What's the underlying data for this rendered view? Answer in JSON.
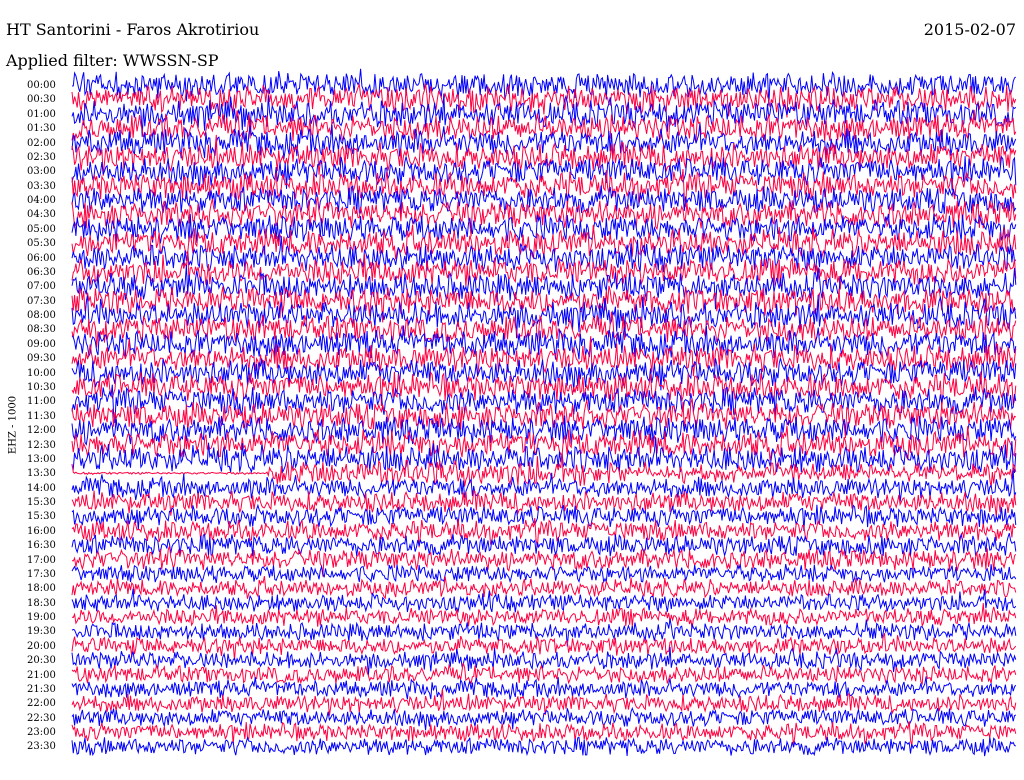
{
  "header": {
    "station": "HT Santorini - Faros Akrotiriou",
    "date": "2015-02-07",
    "filter": "Applied filter: WWSSN-SP"
  },
  "chart_data": {
    "type": "line",
    "title": "HT Santorini - Faros Akrotiriou",
    "ylabel": "EHZ - 1000",
    "xlabel": "",
    "categories": [
      "00:00",
      "00:30",
      "01:00",
      "01:30",
      "02:00",
      "02:30",
      "03:00",
      "03:30",
      "04:00",
      "04:30",
      "05:00",
      "05:30",
      "06:00",
      "06:30",
      "07:00",
      "07:30",
      "08:00",
      "08:30",
      "09:00",
      "09:30",
      "10:00",
      "10:30",
      "11:00",
      "11:30",
      "12:00",
      "12:30",
      "13:00",
      "13:30",
      "14:00",
      "14:30",
      "15:00",
      "15:30",
      "16:00",
      "16:30",
      "17:00",
      "17:30",
      "18:00",
      "18:30",
      "19:00",
      "19:30",
      "20:00",
      "20:30",
      "21:00",
      "21:30",
      "22:00",
      "22:30",
      "23:00",
      "23:30"
    ],
    "tick_labels": [
      "00:00",
      "00:30",
      "01:00",
      "01:30",
      "02:00",
      "02:30",
      "03:00",
      "03:30",
      "04:00",
      "04:30",
      "05:00",
      "05:30",
      "06:00",
      "06:30",
      "07:00",
      "07:30",
      "08:00",
      "08:30",
      "09:00",
      "09:30",
      "10:00",
      "10:30",
      "11:00",
      "11:30",
      "12:00",
      "12:30",
      "13:00",
      "13:30",
      "14:00",
      "15:30",
      "15:30",
      "16:00",
      "16:30",
      "17:00",
      "17:30",
      "18:00",
      "18:30",
      "19:00",
      "19:30",
      "20:00",
      "20:30",
      "21:00",
      "21:30",
      "22:00",
      "22:30",
      "23:00",
      "23:30"
    ],
    "series": [
      {
        "color": "#0000ff"
      },
      {
        "color": "#ff0040"
      }
    ],
    "grid": false,
    "legend": "none"
  }
}
